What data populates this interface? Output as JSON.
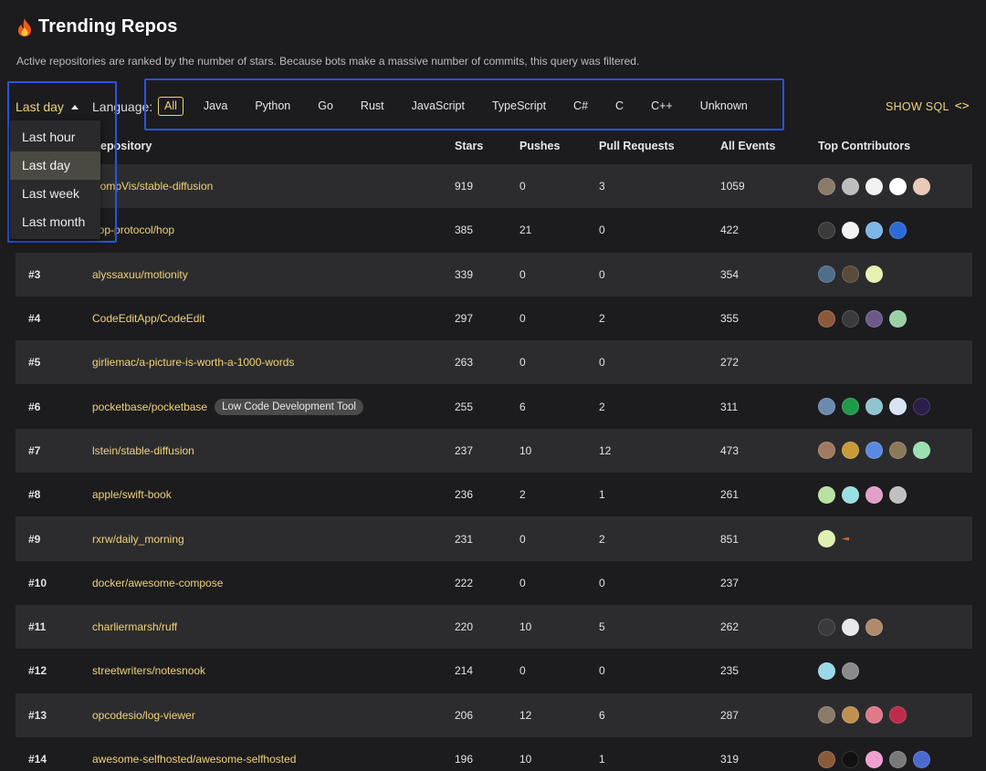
{
  "header": {
    "title": "Trending Repos",
    "subtitle": "Active repositories are ranked by the number of stars. Because bots make a massive number of commits, this query was filtered."
  },
  "controls": {
    "period_selected": "Last day",
    "language_label": "Language:",
    "languages": [
      "All",
      "Java",
      "Python",
      "Go",
      "Rust",
      "JavaScript",
      "TypeScript",
      "C#",
      "C",
      "C++",
      "Unknown"
    ],
    "language_active": "All",
    "show_sql": "SHOW SQL",
    "show_sql_icon": "<>"
  },
  "dropdown": {
    "options": [
      "Last hour",
      "Last day",
      "Last week",
      "Last month"
    ],
    "selected": "Last day"
  },
  "table": {
    "columns": {
      "repository": "Repository",
      "stars": "Stars",
      "pushes": "Pushes",
      "pull_requests": "Pull Requests",
      "all_events": "All Events",
      "top_contributors": "Top Contributors"
    },
    "rows": [
      {
        "rank": "",
        "repo": "CompVis/stable-diffusion",
        "stars": "919",
        "pushes": "0",
        "prs": "3",
        "events": "1059",
        "tag": "",
        "avatars": [
          "#8a7a6a",
          "#bdbdbd",
          "#f2f2f2",
          "#ffffff",
          "#e9c9b8"
        ]
      },
      {
        "rank": "",
        "repo": "hop-protocol/hop",
        "stars": "385",
        "pushes": "21",
        "prs": "0",
        "events": "422",
        "tag": "",
        "avatars": [
          "#3b3b3b",
          "#f3f3f3",
          "#7fb6e8",
          "#2e6bd6"
        ]
      },
      {
        "rank": "#3",
        "repo": "alyssaxuu/motionity",
        "stars": "339",
        "pushes": "0",
        "prs": "0",
        "events": "354",
        "tag": "",
        "avatars": [
          "#4f6e8a",
          "#5a4b3c",
          "#e6f0b0"
        ]
      },
      {
        "rank": "#4",
        "repo": "CodeEditApp/CodeEdit",
        "stars": "297",
        "pushes": "0",
        "prs": "2",
        "events": "355",
        "tag": "",
        "avatars": [
          "#8a5a3a",
          "#3a3a3a",
          "#6c5a8a",
          "#9ad0a6"
        ]
      },
      {
        "rank": "#5",
        "repo": "girliemac/a-picture-is-worth-a-1000-words",
        "stars": "263",
        "pushes": "0",
        "prs": "0",
        "events": "272",
        "tag": "",
        "avatars": []
      },
      {
        "rank": "#6",
        "repo": "pocketbase/pocketbase",
        "stars": "255",
        "pushes": "6",
        "prs": "2",
        "events": "311",
        "tag": "Low Code Development Tool",
        "avatars": [
          "#6a8ab0",
          "#1f9a4a",
          "#8fc4d0",
          "#d8e4f4",
          "#2a1e4a"
        ]
      },
      {
        "rank": "#7",
        "repo": "lstein/stable-diffusion",
        "stars": "237",
        "pushes": "10",
        "prs": "12",
        "events": "473",
        "tag": "",
        "avatars": [
          "#a07a60",
          "#c89a3a",
          "#5a8ae0",
          "#8a7a5a",
          "#9ae0b0"
        ]
      },
      {
        "rank": "#8",
        "repo": "apple/swift-book",
        "stars": "236",
        "pushes": "2",
        "prs": "1",
        "events": "261",
        "tag": "",
        "avatars": [
          "#b8e0a0",
          "#9ae0e0",
          "#e0a0c8",
          "#c0c0c0"
        ]
      },
      {
        "rank": "#9",
        "repo": "rxrw/daily_morning",
        "stars": "231",
        "pushes": "0",
        "prs": "2",
        "events": "851",
        "tag": "",
        "avatars": [
          "#e0f0b0",
          "tiny"
        ]
      },
      {
        "rank": "#10",
        "repo": "docker/awesome-compose",
        "stars": "222",
        "pushes": "0",
        "prs": "0",
        "events": "237",
        "tag": "",
        "avatars": []
      },
      {
        "rank": "#11",
        "repo": "charliermarsh/ruff",
        "stars": "220",
        "pushes": "10",
        "prs": "5",
        "events": "262",
        "tag": "",
        "avatars": [
          "#3a3a3a",
          "#e8e8e8",
          "#b08a6a"
        ]
      },
      {
        "rank": "#12",
        "repo": "streetwriters/notesnook",
        "stars": "214",
        "pushes": "0",
        "prs": "0",
        "events": "235",
        "tag": "",
        "avatars": [
          "#9ad8e8",
          "#8a8a8a"
        ]
      },
      {
        "rank": "#13",
        "repo": "opcodesio/log-viewer",
        "stars": "206",
        "pushes": "12",
        "prs": "6",
        "events": "287",
        "tag": "",
        "avatars": [
          "#8a7a6a",
          "#c09050",
          "#e07a8a",
          "#c02a4a"
        ]
      },
      {
        "rank": "#14",
        "repo": "awesome-selfhosted/awesome-selfhosted",
        "stars": "196",
        "pushes": "10",
        "prs": "1",
        "events": "319",
        "tag": "",
        "avatars": [
          "#8a5a3a",
          "#111111",
          "#f0a0d0",
          "#7a7a7a",
          "#4a6ad0"
        ]
      }
    ]
  }
}
